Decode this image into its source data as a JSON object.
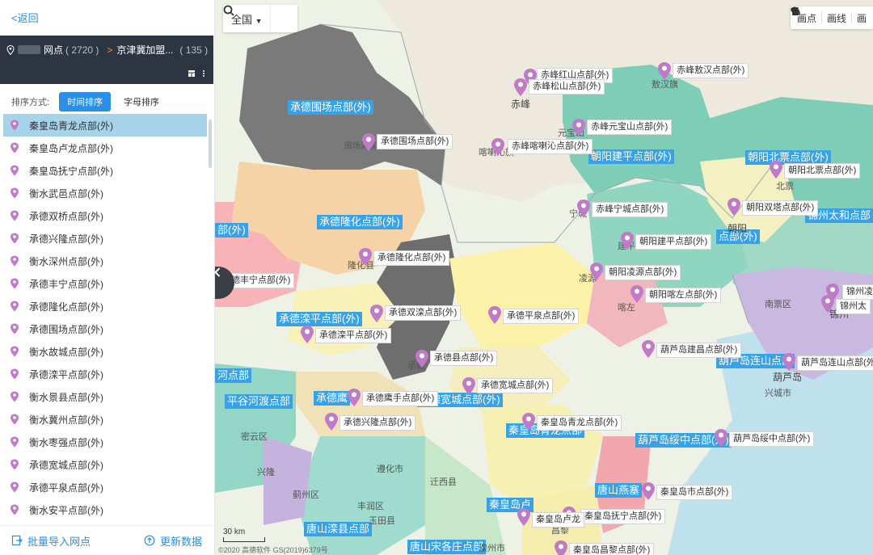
{
  "sidebar": {
    "back_label": "<返回",
    "path": {
      "level1_suffix": "网点",
      "level1_count": "( 2720 )",
      "arrow": ">",
      "level2": "京津冀加盟...",
      "level2_count": "( 135 )"
    },
    "sort": {
      "label": "排序方式:",
      "options": [
        "时间排序",
        "字母排序"
      ],
      "active": "时间排序"
    },
    "items": [
      "秦皇岛青龙点部(外)",
      "秦皇岛卢龙点部(外)",
      "秦皇岛抚宁点部(外)",
      "衡水武邑点部(外)",
      "承德双桥点部(外)",
      "承德兴隆点部(外)",
      "衡水深州点部(外)",
      "承德丰宁点部(外)",
      "承德隆化点部(外)",
      "承德围场点部(外)",
      "衡水故城点部(外)",
      "承德滦平点部(外)",
      "衡水景县点部(外)",
      "衡水冀州点部(外)",
      "衡水枣强点部(外)",
      "承德宽城点部(外)",
      "承德平泉点部(外)",
      "衡水安平点部(外)"
    ],
    "selected_index": 0,
    "bottom": {
      "import_label": "批量导入网点",
      "refresh_label": "更新数据"
    }
  },
  "map": {
    "region_select": "全国",
    "tools": [
      "画点",
      "画线",
      "画"
    ],
    "scale_label": "30 km",
    "copyright": "©2020 高德软件 GS(2019)6379号",
    "colors": {
      "accent": "#2a8fe6",
      "marker": "#c17ac9",
      "label_bg": "#39a2e6"
    },
    "area_labels": [
      "承德围场点部(外)",
      "承德隆化点部(外)",
      "部(外)",
      "承德滦平点部(外)",
      "朝阳建平点部(外)",
      "朝阳北票点部(外)",
      "锦州太和点部",
      "点部(外)",
      "葫芦岛连山点部",
      "葫芦岛绥中点部(外)",
      "承德宽城点部(外)",
      "秦皇岛青龙点部",
      "平谷河渡点部",
      "唐山燕塞",
      "唐山滦县点部",
      "秦皇岛卢",
      "唐山宋各庄点部",
      "河点部",
      "承德鹰"
    ],
    "markers": [
      "赤峰红山点部(外)",
      "赤峰松山点部(外)",
      "赤峰敖汉点部(外)",
      "赤峰元宝山点部(外)",
      "承德围场点部(外)",
      "赤峰喀喇沁点部(外)",
      "朝阳北票点部(外)",
      "赤峰宁城点部(外)",
      "朝阳双塔点部(外)",
      "朝阳建平点部(外)",
      "承德隆化点部(外)",
      "朝阳凌源点部(外)",
      "朝阳喀左点部(外)",
      "承德丰宁点部(外)",
      "锦州凌",
      "锦州太",
      "承德双滦点部(外)",
      "承德平泉点部(外)",
      "承德滦平点部(外)",
      "葫芦岛建昌点部(外)",
      "葫芦岛连山点部(外)",
      "承德县点部(外)",
      "承德宽城点部(外)",
      "承德鹰手点部(外)",
      "承德兴隆点部(外)",
      "秦皇岛青龙点部(外)",
      "葫芦岛绥中点部(外)",
      "秦皇岛市点部(外)",
      "秦皇岛抚宁点部(外)",
      "秦皇岛卢龙",
      "秦皇岛昌黎点部(外)"
    ],
    "cities": [
      "赤峰",
      "敖汉旗",
      "元宝山",
      "喀喇沁旗",
      "围场满族蒙古族自治县",
      "宁城",
      "朝阳",
      "建平",
      "凌源",
      "喀左",
      "北票",
      "南票区",
      "葫芦岛",
      "兴城市",
      "锦州",
      "隆化县",
      "迁西县",
      "密云区",
      "遵化市",
      "蓟州区",
      "玉田县",
      "丰润区",
      "滦州市",
      "兴隆",
      "昌黎",
      "承德"
    ]
  }
}
